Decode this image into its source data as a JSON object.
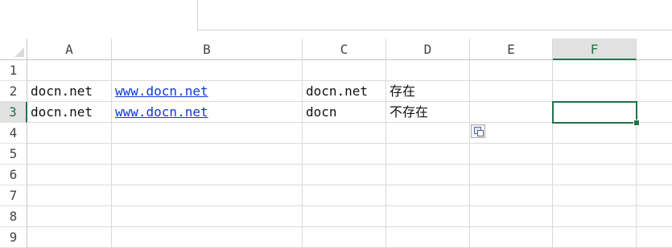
{
  "columns": [
    "A",
    "B",
    "C",
    "D",
    "E",
    "F"
  ],
  "rows": [
    "1",
    "2",
    "3",
    "4",
    "5",
    "6",
    "7",
    "8",
    "9"
  ],
  "cells": {
    "A2": "docn.net",
    "B2": "www.docn.net",
    "C2": "docn.net",
    "D2": "存在",
    "A3": "docn.net",
    "B3": "www.docn.net",
    "C3": "docn",
    "D3": "不存在"
  },
  "active_cell": "F3",
  "colors": {
    "accent": "#217346",
    "link": "#0b3bd6",
    "header_selected_bg": "#e1e1e1"
  },
  "icons": {
    "paste_options": "paste-options-icon",
    "select_all": "select-all-triangle-icon"
  }
}
